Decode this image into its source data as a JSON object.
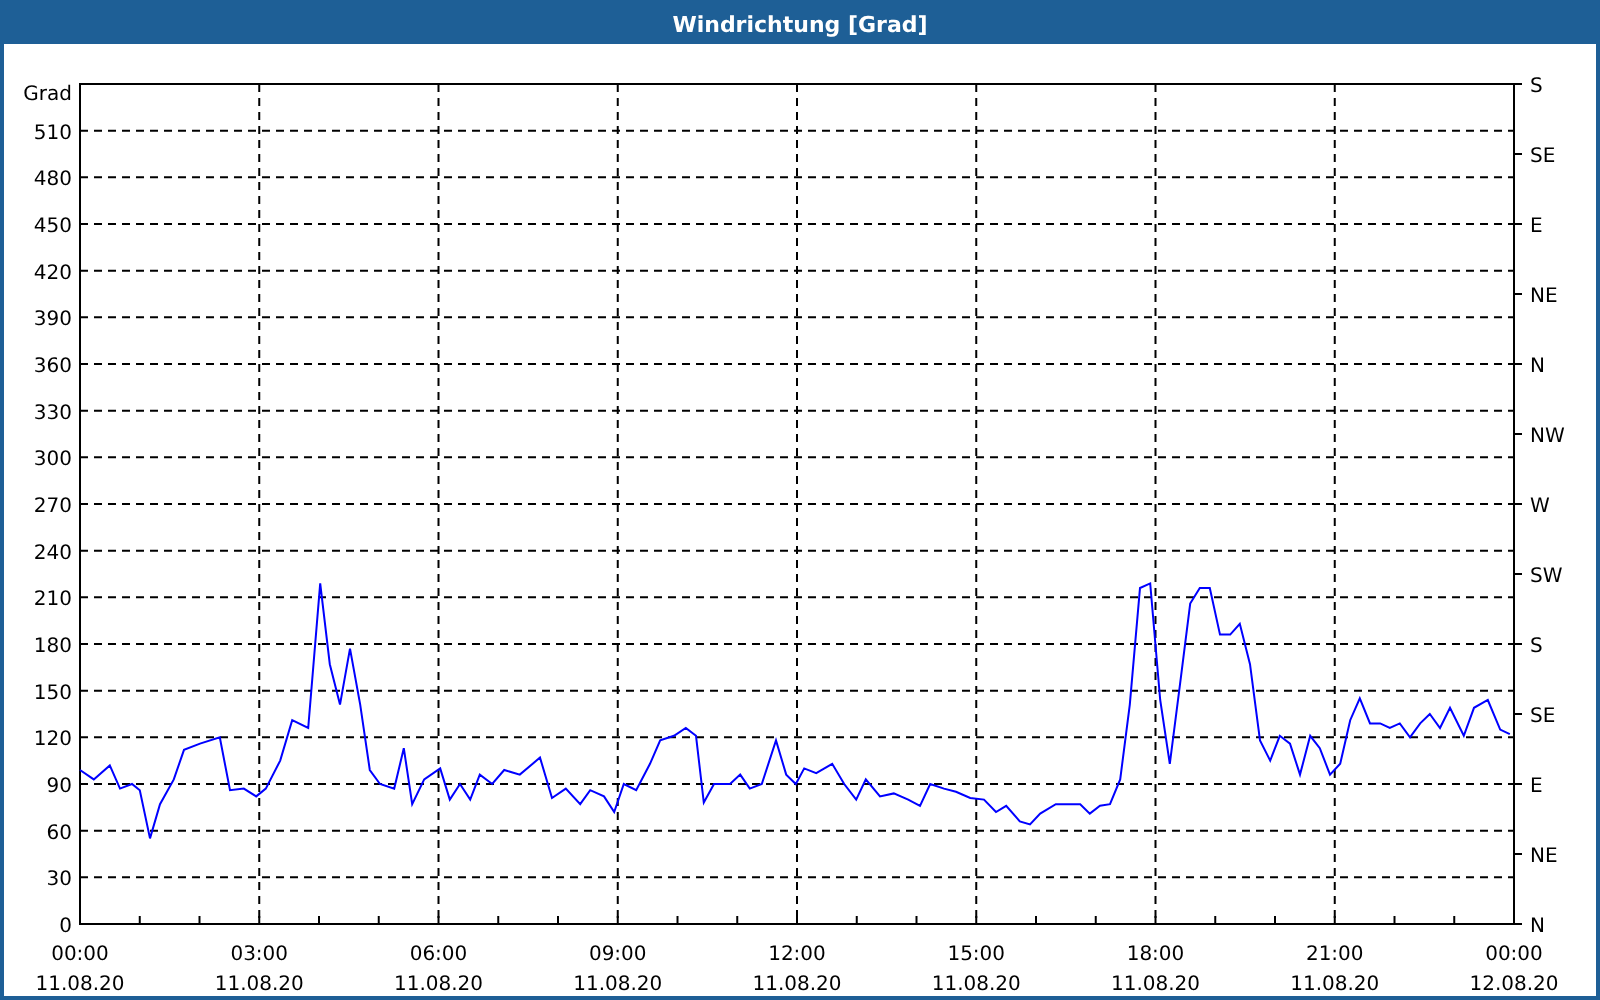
{
  "window": {
    "title": "Windrichtung [Grad]"
  },
  "chart": {
    "chart_data": {
      "type": "line",
      "grid": true,
      "ylabel": "Grad",
      "xlim": [
        0,
        24
      ],
      "ylim": [
        0,
        540
      ],
      "yticks": [
        0,
        30,
        60,
        90,
        120,
        150,
        180,
        210,
        240,
        270,
        300,
        330,
        360,
        390,
        420,
        450,
        480,
        510
      ],
      "xticks": [
        {
          "value": 0,
          "label": "00:00"
        },
        {
          "value": 3,
          "label": "03:00"
        },
        {
          "value": 6,
          "label": "06:00"
        },
        {
          "value": 9,
          "label": "09:00"
        },
        {
          "value": 12,
          "label": "12:00"
        },
        {
          "value": 15,
          "label": "15:00"
        },
        {
          "value": 18,
          "label": "18:00"
        },
        {
          "value": 21,
          "label": "21:00"
        },
        {
          "value": 24,
          "label": "00:00"
        }
      ],
      "x": [
        0,
        0.23,
        0.5,
        0.67,
        0.87,
        1.0,
        1.17,
        1.34,
        1.57,
        1.74,
        2.01,
        2.34,
        2.51,
        2.74,
        2.95,
        3.11,
        3.35,
        3.55,
        3.82,
        4.02,
        4.18,
        4.35,
        4.52,
        4.69,
        4.85,
        5.02,
        5.26,
        5.42,
        5.56,
        5.76,
        6.03,
        6.19,
        6.36,
        6.53,
        6.69,
        6.9,
        7.1,
        7.36,
        7.7,
        7.9,
        8.13,
        8.37,
        8.54,
        8.77,
        8.94,
        9.1,
        9.31,
        9.54,
        9.71,
        9.94,
        10.14,
        10.31,
        10.44,
        10.61,
        10.88,
        11.05,
        11.21,
        11.41,
        11.65,
        11.82,
        11.98,
        12.12,
        12.32,
        12.59,
        12.79,
        12.99,
        13.15,
        13.39,
        13.62,
        13.86,
        14.06,
        14.23,
        14.46,
        14.66,
        14.9,
        15.13,
        15.33,
        15.5,
        15.73,
        15.9,
        16.07,
        16.33,
        16.74,
        16.9,
        17.07,
        17.24,
        17.41,
        17.57,
        17.74,
        17.91,
        18.08,
        18.24,
        18.41,
        18.58,
        18.74,
        18.91,
        19.08,
        19.25,
        19.41,
        19.58,
        19.75,
        19.92,
        20.08,
        20.25,
        20.42,
        20.59,
        20.75,
        20.92,
        21.09,
        21.26,
        21.42,
        21.59,
        21.76,
        21.92,
        22.09,
        22.26,
        22.43,
        22.59,
        22.76,
        22.93,
        23.16,
        23.33,
        23.56,
        23.77,
        23.93
      ],
      "series": [
        {
          "color": "#0000ff",
          "values": [
            99,
            93,
            102,
            87,
            90,
            86,
            55,
            77,
            93,
            112,
            116,
            120,
            86,
            87,
            82,
            87,
            105,
            131,
            126,
            219,
            167,
            141,
            177,
            141,
            99,
            90,
            87,
            113,
            77,
            93,
            100,
            80,
            90,
            80,
            96,
            90,
            99,
            96,
            107,
            81,
            87,
            77,
            86,
            82,
            72,
            90,
            86,
            103,
            118,
            121,
            126,
            121,
            78,
            90,
            90,
            96,
            87,
            90,
            118,
            96,
            90,
            100,
            97,
            103,
            90,
            80,
            93,
            82,
            84,
            80,
            76,
            90,
            87,
            85,
            81,
            80,
            72,
            76,
            66,
            64,
            71,
            77,
            77,
            71,
            76,
            77,
            93,
            141,
            216,
            219,
            144,
            103,
            154,
            206,
            216,
            216,
            186,
            186,
            193,
            167,
            118,
            105,
            121,
            116,
            96,
            121,
            113,
            96,
            103,
            131,
            145,
            129,
            129,
            126,
            129,
            120,
            129,
            135,
            126,
            139,
            121,
            139,
            144,
            125,
            122
          ]
        }
      ]
    },
    "xtick_dates": [
      "11.08.20",
      "11.08.20",
      "11.08.20",
      "11.08.20",
      "11.08.20",
      "11.08.20",
      "11.08.20",
      "11.08.20",
      "12.08.20"
    ],
    "right_axis_labels": [
      "S",
      "SE",
      "E",
      "NE",
      "N",
      "NW",
      "W",
      "SW",
      "S",
      "SE",
      "E",
      "NE",
      "N"
    ]
  }
}
